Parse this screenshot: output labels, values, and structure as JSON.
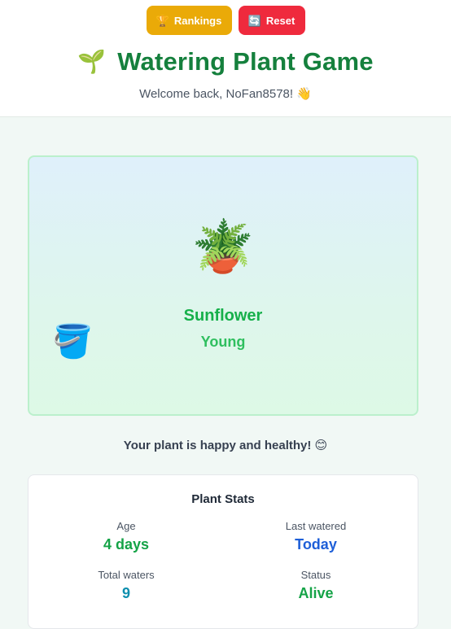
{
  "header": {
    "rankings": {
      "icon": "🏆",
      "label": "Rankings"
    },
    "reset": {
      "icon": "🔄",
      "label": "Reset"
    },
    "title_icon": "🌱",
    "title": "Watering Plant Game",
    "welcome": "Welcome back, NoFan8578! 👋"
  },
  "scene": {
    "plant_icon": "🪴",
    "plant_name": "Sunflower",
    "plant_stage": "Young",
    "bucket_icon": "🪣"
  },
  "message": "Your plant is happy and healthy! 😊",
  "stats": {
    "title": "Plant Stats",
    "age_label": "Age",
    "age_value": "4 days",
    "last_watered_label": "Last watered",
    "last_watered_value": "Today",
    "total_waters_label": "Total waters",
    "total_waters_value": "9",
    "status_label": "Status",
    "status_value": "Alive"
  },
  "colors": {
    "title": "#15803d",
    "rankings_button": "#eaaa08",
    "reset_button": "#ef2a3d",
    "plant_name": "#16b04a",
    "stat_blue": "#1e5fd8",
    "stat_cyan": "#0e8fae"
  }
}
